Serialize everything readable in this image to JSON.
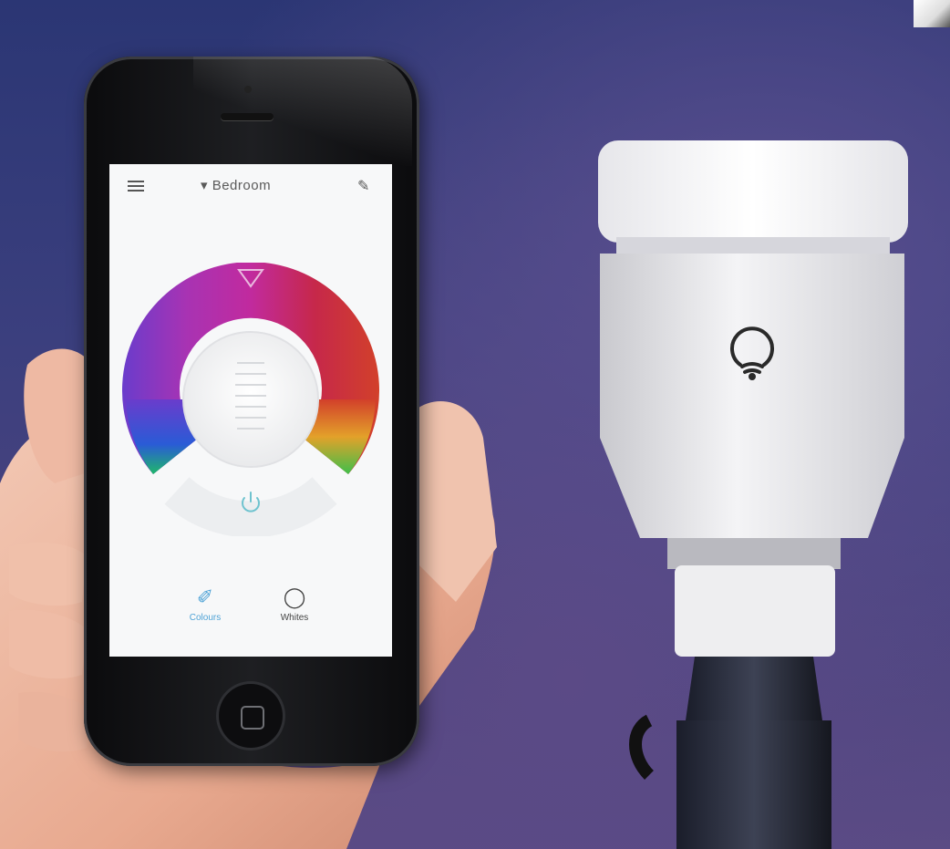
{
  "app": {
    "room_title": "Bedroom",
    "tabs": [
      {
        "label": "Colours",
        "icon": "brush-icon"
      },
      {
        "label": "Whites",
        "icon": "ring-icon"
      }
    ]
  },
  "colors": {
    "background": "#3b3f7e",
    "accent": "#4fa3d6",
    "wheel_top": "#c02ea1",
    "wheel_left": "#7b3cc4",
    "wheel_right": "#d2252f"
  }
}
